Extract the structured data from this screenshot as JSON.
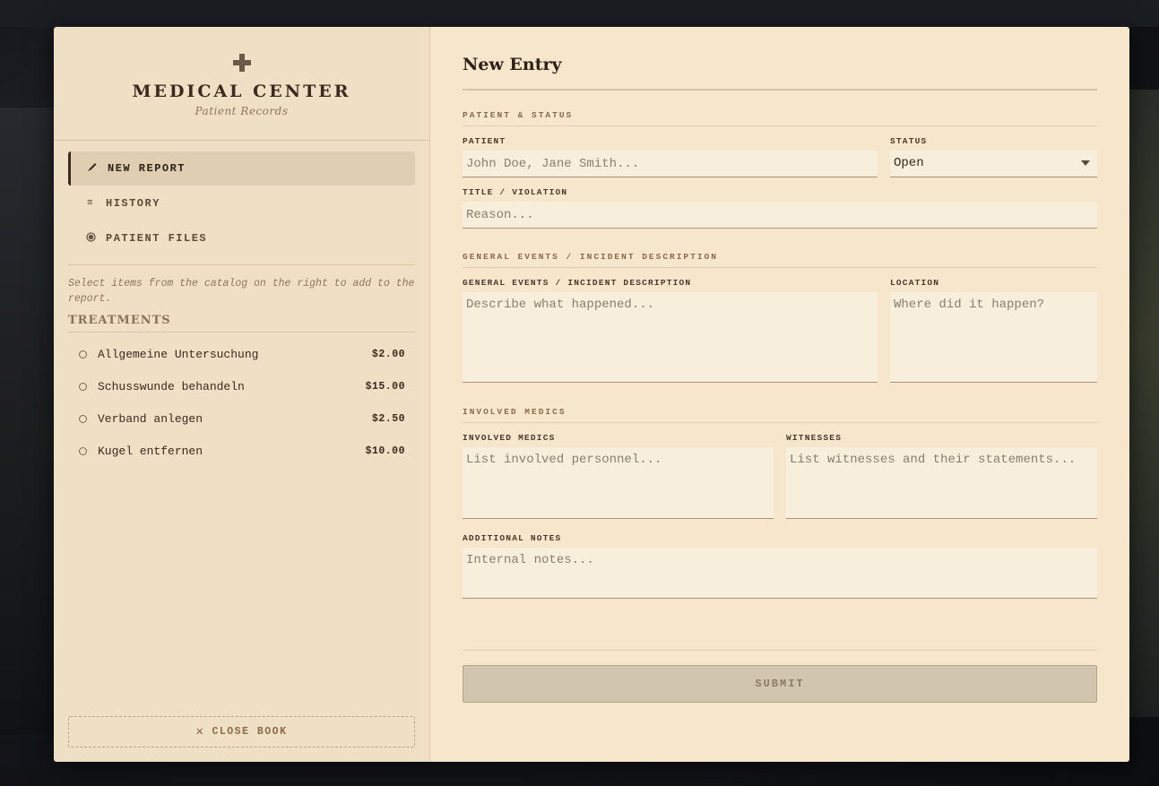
{
  "brand": {
    "title": "MEDICAL CENTER",
    "subtitle": "Patient Records"
  },
  "nav": [
    {
      "label": "NEW REPORT",
      "icon": "pen-icon",
      "active": true
    },
    {
      "label": "HISTORY",
      "icon": "list-icon",
      "active": false
    },
    {
      "label": "PATIENT FILES",
      "icon": "circle-dot-icon",
      "active": false
    }
  ],
  "hint": "Select items from the catalog on the right to add to the report.",
  "treatments": {
    "heading": "TREATMENTS",
    "items": [
      {
        "name": "Allgemeine Untersuchung",
        "price": "$2.00"
      },
      {
        "name": "Schusswunde behandeln",
        "price": "$15.00"
      },
      {
        "name": "Verband anlegen",
        "price": "$2.50"
      },
      {
        "name": "Kugel entfernen",
        "price": "$10.00"
      }
    ]
  },
  "close_label": "CLOSE BOOK",
  "form": {
    "title": "New Entry",
    "sections": {
      "patient_status": "PATIENT & STATUS",
      "events": "GENERAL EVENTS / INCIDENT DESCRIPTION",
      "medics": "INVOLVED MEDICS"
    },
    "patient": {
      "label": "PATIENT",
      "placeholder": "John Doe, Jane Smith..."
    },
    "status": {
      "label": "STATUS",
      "value": "Open"
    },
    "title_field": {
      "label": "TITLE / VIOLATION",
      "placeholder": "Reason..."
    },
    "description": {
      "label": "GENERAL EVENTS / INCIDENT DESCRIPTION",
      "placeholder": "Describe what happened..."
    },
    "location": {
      "label": "LOCATION",
      "placeholder": "Where did it happen?"
    },
    "medics": {
      "label": "INVOLVED MEDICS",
      "placeholder": "List involved personnel..."
    },
    "witnesses": {
      "label": "WITNESSES",
      "placeholder": "List witnesses and their statements..."
    },
    "notes": {
      "label": "ADDITIONAL NOTES",
      "placeholder": "Internal notes..."
    },
    "submit_label": "SUBMIT"
  },
  "colors": {
    "sidebar_bg": "#efdfc4",
    "main_bg": "#f5e6cc",
    "accent": "#3b2a1d"
  }
}
